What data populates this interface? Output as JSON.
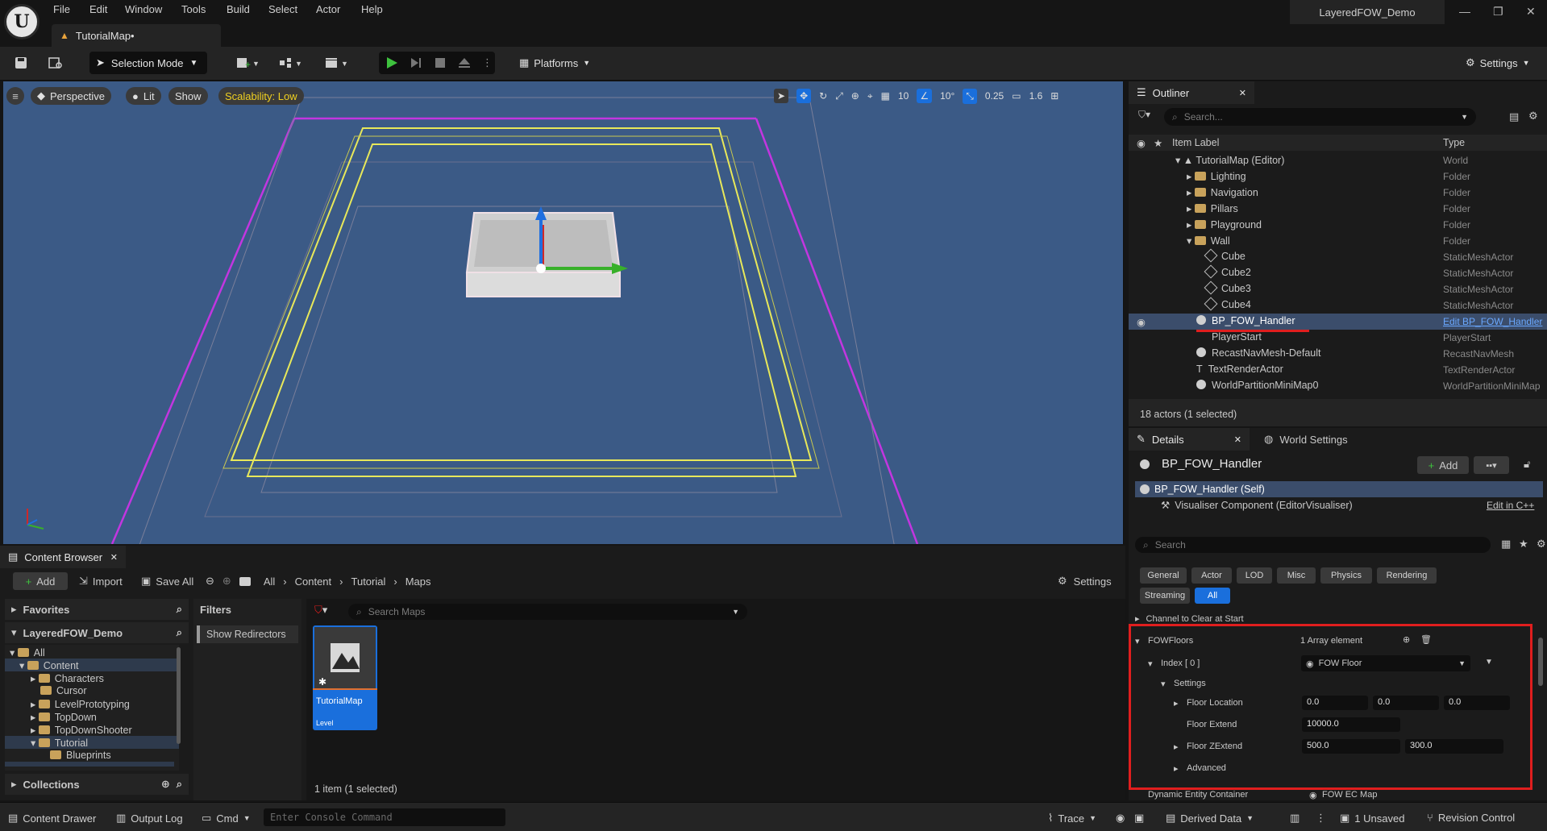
{
  "titlebar": {
    "menu": [
      "File",
      "Edit",
      "Window",
      "Tools",
      "Build",
      "Select",
      "Actor",
      "Help"
    ],
    "map_tab": "TutorialMap•",
    "project_name": "LayeredFOW_Demo"
  },
  "toolbar": {
    "selection_mode": "Selection Mode",
    "platforms": "Platforms",
    "settings": "Settings"
  },
  "viewport": {
    "perspective": "Perspective",
    "lit": "Lit",
    "show": "Show",
    "scalability": "Scalability: Low",
    "grid_size": "10",
    "rotation_snap": "10°",
    "scale_snap": "0.25",
    "camera_speed": "1.6"
  },
  "outliner": {
    "tab": "Outliner",
    "search_placeholder": "Search...",
    "col_label": "Item Label",
    "col_type": "Type",
    "rows": [
      {
        "label": "TutorialMap (Editor)",
        "type": "World"
      },
      {
        "label": "Lighting",
        "type": "Folder"
      },
      {
        "label": "Navigation",
        "type": "Folder"
      },
      {
        "label": "Pillars",
        "type": "Folder"
      },
      {
        "label": "Playground",
        "type": "Folder"
      },
      {
        "label": "Wall",
        "type": "Folder"
      },
      {
        "label": "Cube",
        "type": "StaticMeshActor"
      },
      {
        "label": "Cube2",
        "type": "StaticMeshActor"
      },
      {
        "label": "Cube3",
        "type": "StaticMeshActor"
      },
      {
        "label": "Cube4",
        "type": "StaticMeshActor"
      },
      {
        "label": "BP_FOW_Handler",
        "type": "Edit BP_FOW_Handler"
      },
      {
        "label": "PlayerStart",
        "type": "PlayerStart"
      },
      {
        "label": "RecastNavMesh-Default",
        "type": "RecastNavMesh"
      },
      {
        "label": "TextRenderActor",
        "type": "TextRenderActor"
      },
      {
        "label": "WorldPartitionMiniMap0",
        "type": "WorldPartitionMiniMap"
      }
    ],
    "footer": "18 actors (1 selected)"
  },
  "details": {
    "tab": "Details",
    "world_settings_tab": "World Settings",
    "actor_name": "BP_FOW_Handler",
    "add_label": "Add",
    "self_component": "BP_FOW_Handler (Self)",
    "visualiser_component": "Visualiser Component (EditorVisualiser)",
    "edit_cpp": "Edit in C++",
    "search_placeholder": "Search",
    "categories_row1": [
      "General",
      "Actor",
      "LOD",
      "Misc",
      "Physics",
      "Rendering"
    ],
    "categories_row2": [
      "Streaming",
      "All"
    ],
    "channel_clear": "Channel to Clear at Start",
    "fow_floors": "FOWFloors",
    "array_count": "1 Array element",
    "index_label": "Index [ 0 ]",
    "index_value": "FOW Floor",
    "settings_label": "Settings",
    "floor_location": "Floor Location",
    "floor_location_values": [
      "0.0",
      "0.0",
      "0.0"
    ],
    "floor_extend": "Floor Extend",
    "floor_extend_value": "10000.0",
    "floor_zextend": "Floor ZExtend",
    "floor_zextend_values": [
      "500.0",
      "300.0"
    ],
    "advanced": "Advanced",
    "dynamic_entity": "Dynamic Entity Container",
    "dynamic_entity_value": "FOW EC Map"
  },
  "content_browser": {
    "tab": "Content Browser",
    "add": "Add",
    "import": "Import",
    "save_all": "Save All",
    "breadcrumb": [
      "All",
      "Content",
      "Tutorial",
      "Maps"
    ],
    "settings": "Settings",
    "favorites": "Favorites",
    "project": "LayeredFOW_Demo",
    "tree": [
      "All",
      "Content",
      "Characters",
      "Cursor",
      "LevelPrototyping",
      "TopDown",
      "TopDownShooter",
      "Tutorial",
      "Blueprints"
    ],
    "collections": "Collections",
    "filters": "Filters",
    "show_redirectors": "Show Redirectors",
    "search_placeholder": "Search Maps",
    "asset_name": "TutorialMap",
    "asset_type": "Level",
    "item_count": "1 item (1 selected)"
  },
  "statusbar": {
    "content_drawer": "Content Drawer",
    "output_log": "Output Log",
    "cmd": "Cmd",
    "console_placeholder": "Enter Console Command",
    "trace": "Trace",
    "derived_data": "Derived Data",
    "unsaved": "1 Unsaved",
    "revision_control": "Revision Control"
  },
  "colors": {
    "accent_blue": "#1a6fdc",
    "highlight_red": "#e01e1e",
    "viewport_bg": "#3b5a86",
    "play_green": "#3ec23e"
  }
}
